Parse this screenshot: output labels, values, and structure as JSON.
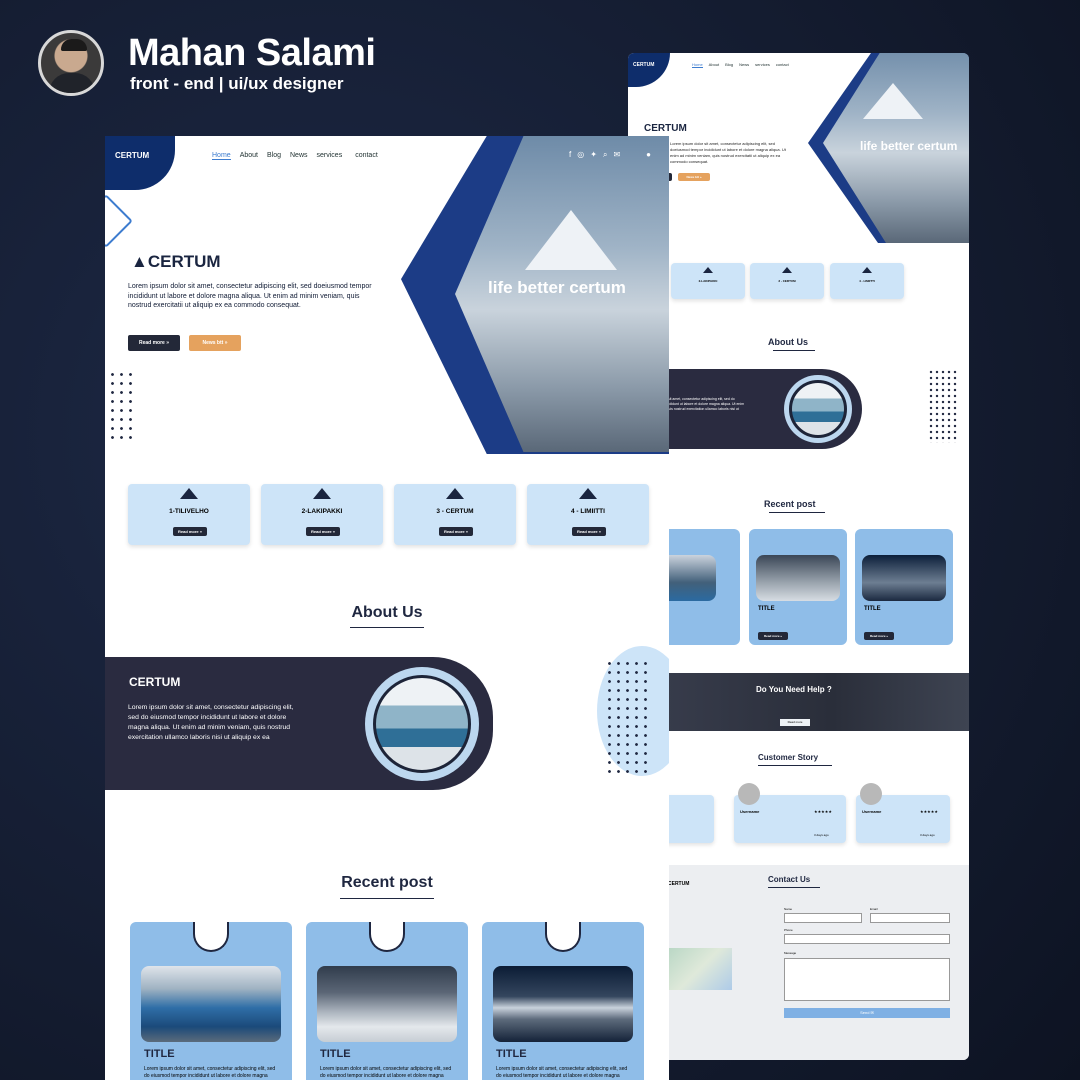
{
  "designer": {
    "name": "Mahan Salami",
    "role": "front - end | ui/ux designer"
  },
  "nav": {
    "items": [
      "Home",
      "About",
      "Blog",
      "News",
      "services",
      "contact"
    ]
  },
  "brand": "CERTUM",
  "hero": {
    "tagline": "life better certum",
    "body": "Lorem ipsum dolor sit amet, consectetur adipiscing elit, sed doeiusmod tempor incididunt ut labore et dolore magna aliqua. Ut enim ad minim veniam, quis nostrud exercitatii ut aliquip ex ea commodo consequat.",
    "btn_read": "Read more »",
    "btn_news": "News btt »"
  },
  "features": [
    {
      "title": "1-TILIVELHO",
      "btn": "Read more »"
    },
    {
      "title": "2-LAKIPAKKI",
      "btn": "Read more »"
    },
    {
      "title": "3 - CERTUM",
      "btn": "Read more »"
    },
    {
      "title": "4 - LIMIITTI",
      "btn": "Read more »"
    }
  ],
  "about": {
    "title": "About Us",
    "brand": "CERTUM",
    "body": "Lorem ipsum dolor sit amet, consectetur adipiscing elit, sed do eiusmod tempor incididunt ut labore et dolore magna aliqua. Ut enim ad minim veniam, quis nostrud exercitation ullamco laboris nisi ut aliquip ex ea"
  },
  "recent": {
    "title": "Recent post",
    "posts": [
      {
        "title": "TITLE",
        "body": "Lorem ipsum dolor sit amet, consectetur adipiscing elit, sed do eiusmod tempor incididunt ut labore et dolore magna aliqua. Ut"
      },
      {
        "title": "TITLE",
        "body": "Lorem ipsum dolor sit amet, consectetur adipiscing elit, sed do eiusmod tempor incididunt ut labore et dolore magna aliqua. Ut"
      },
      {
        "title": "TITLE",
        "body": "Lorem ipsum dolor sit amet, consectetur adipiscing elit, sed do eiusmod tempor incididunt ut labore et dolore magna aliqua. Ut"
      }
    ],
    "read_more": "Read more »"
  },
  "help": {
    "title": "Do You Need Help ?",
    "btn": "Read more"
  },
  "customer": {
    "title": "Customer Story",
    "user": "Username",
    "stars": "★★★★★",
    "age": "3 days ago"
  },
  "contact": {
    "title": "Contact Us",
    "labels": {
      "name": "Name",
      "email": "Email",
      "phone": "Phone",
      "message": "Message"
    },
    "send": "Send ✉"
  },
  "colors": {
    "navy": "#0e2d6b",
    "dark": "#2a2b40",
    "card": "#cde4f8",
    "post": "#8fbde8",
    "orange": "#e5a25e"
  }
}
